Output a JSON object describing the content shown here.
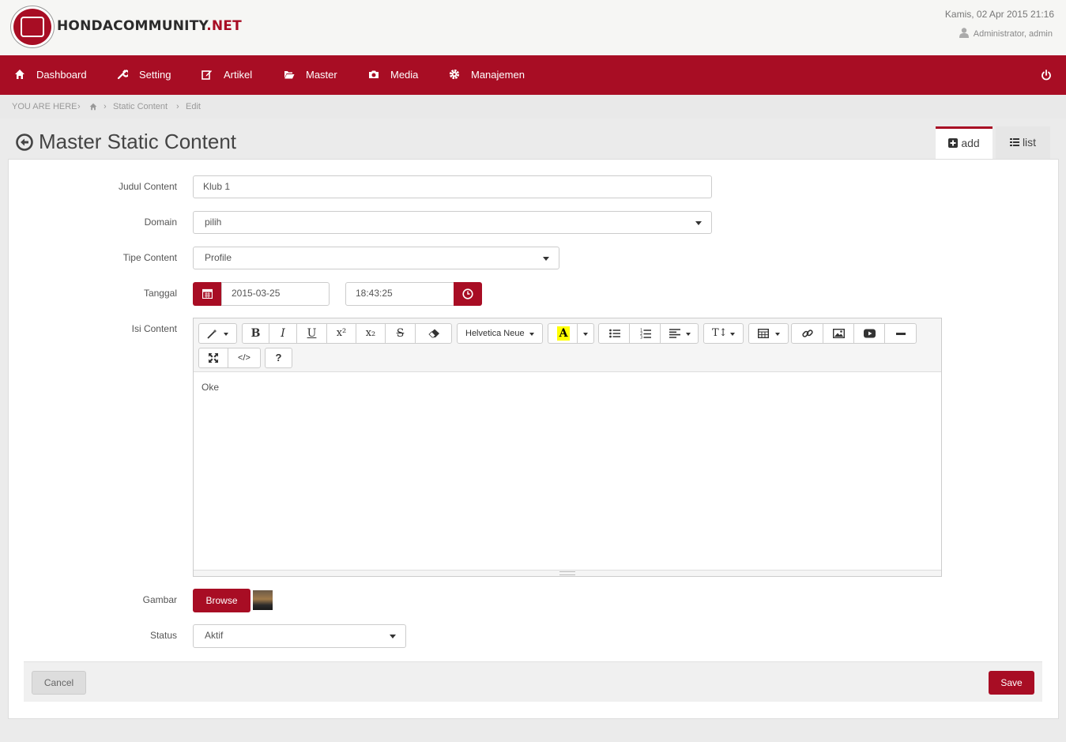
{
  "header": {
    "brand_main": "HONDACOMMUNITY",
    "brand_suffix": ".NET",
    "datetime": "Kamis, 02 Apr 2015 21:16",
    "user": "Administrator, admin"
  },
  "nav": {
    "items": [
      {
        "label": "Dashboard",
        "icon": "home-icon"
      },
      {
        "label": "Setting",
        "icon": "wrench-icon"
      },
      {
        "label": "Artikel",
        "icon": "edit-icon"
      },
      {
        "label": "Master",
        "icon": "folder-open-icon"
      },
      {
        "label": "Media",
        "icon": "camera-icon"
      },
      {
        "label": "Manajemen",
        "icon": "gear-icon"
      }
    ]
  },
  "breadcrumb": {
    "prefix": "YOU ARE HERE",
    "items": [
      "Static Content",
      "Edit"
    ]
  },
  "page": {
    "title": "Master Static Content",
    "tabs": [
      {
        "label": "add",
        "active": true
      },
      {
        "label": "list",
        "active": false
      }
    ]
  },
  "form": {
    "judul": {
      "label": "Judul Content",
      "value": "Klub 1"
    },
    "domain": {
      "label": "Domain",
      "value": "pilih"
    },
    "tipe": {
      "label": "Tipe Content",
      "value": "Profile"
    },
    "tanggal": {
      "label": "Tanggal",
      "date": "2015-03-25",
      "time": "18:43:25"
    },
    "isi": {
      "label": "Isi Content",
      "content": "Oke",
      "font": "Helvetica Neue"
    },
    "gambar": {
      "label": "Gambar",
      "browse_label": "Browse"
    },
    "status": {
      "label": "Status",
      "value": "Aktif"
    }
  },
  "actions": {
    "cancel_label": "Cancel",
    "save_label": "Save"
  },
  "colors": {
    "accent": "#a80d24"
  }
}
